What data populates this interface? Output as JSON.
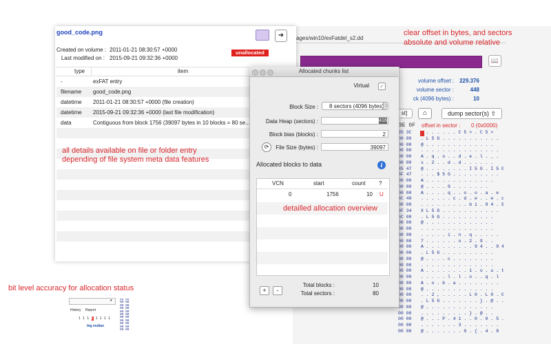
{
  "annotations": {
    "offsets_line1": "clear offset in bytes, and sectors",
    "offsets_line2": "absolute and volume relative",
    "details_line1": "all details available on file or folder entry",
    "details_line2": "depending of file system meta data features",
    "allocation": "detailled allocation overview",
    "bitlevel": "bit level accuracy for allocation status"
  },
  "background_app": {
    "path": "ages/win10/exFatdel_s2.dd",
    "volume_offset_label": "volume offset :",
    "volume_offset_value": "229.376",
    "volume_sector_label": "volume sector :",
    "volume_sector_value": "448",
    "block_label": "ck (4096 bytes) :",
    "block_value": "10",
    "reset_partial": "st]",
    "dump_label": "dump sector(s)",
    "hex_header": "0E 0F",
    "offset_sector_label": "offset in sector :",
    "offset_sector_value": "0 (0x0000)",
    "hex_lines": [
      "85 3C",
      "00 00",
      "00 00",
      "00 00",
      "00 00",
      "00 00",
      "85 47",
      "8F 47",
      "00 00",
      "00 00",
      "00 00",
      "8C 49",
      "00 00",
      "9F 34",
      "5C 00",
      "00 00",
      "00 00",
      "00 00",
      "00 00",
      "00 00",
      "00 00",
      "00 00",
      "00 00",
      "00 00",
      "00 00",
      "00 00",
      "00 00",
      "00 00",
      "00 00",
      "00 00",
      "00 00",
      "00 00",
      "00 00",
      "00 00"
    ],
    "ascii_lines": [
      ". . . . . . . C 5 > . C 5 >",
      ". L 5 G . . . . . . . . . . .",
      "@ . . . . . . . . . . . . .",
      ". . . . . . . . . . . . . . .",
      "A . q . o . . d . e . l . _ .",
      "s . 2 . . d . d . . . . . .",
      "@ . . . . . . . . I 5 G . I 5 G",
      ". . . $ 5 G . . . . . . . . .",
      "A . . . . . . . . . . . . .",
      "@ . . . . 9 . . . . . . .",
      "A . . . . q . . o . o . a . e",
      ". . . . . . c . d . e . . e . o",
      ". . . . . . . . . b i . 9 4 . 9 4",
      "X L 5 G . . . . . . . . . . .",
      ". L 5 G . . . . . . . . . .",
      "@ . . . . . . . . . . . . .",
      ". . . . . . . . . . . . . .",
      ". . . . . i . n . q . . . . .",
      "7 . . . . . . o . 2 . 9 . .",
      "A . . . . . . . . . 9 4 . . 9 4",
      ". L 5 G . . . . . . . . . .",
      "@ . . . . c . . . . . . . .",
      ". . . . . . . . . . . . . .",
      "A . . . . . . . . 1 . o . u . t",
      ". . . . . l . l . o . . q . l",
      "A . o . b . a . . . . . . . .",
      "@ . . . . . . . . . . . . .",
      ". . 2 , . . . . . L 0 . L 0 . 0",
      ". L 5 G . . . . . . . } . @ . .",
      "@ . . . . . . . . . . . . .",
      ". . . . . . . . . } . @ . .",
      "@ . . . P . 4 1 . . 0 . 0 . 5 . 8",
      ". . . . . . . 3 . . . . . . .",
      "@ . . . . . . . 0 . { . 4 . 8"
    ]
  },
  "file_window": {
    "title": "good_code.png",
    "created_label": "Created on volume :",
    "created_value": "2011-01-21 08:30:57 +0000",
    "modified_label": "Last modified on :",
    "modified_value": "2015-09-21 09:32:36 +0000",
    "status_badge": "unallocated",
    "col_type": "type",
    "col_item": "item",
    "rows": [
      {
        "type": "-",
        "item": "exFAT entry"
      },
      {
        "type": "filename",
        "item": "good_code.png"
      },
      {
        "type": "datetime",
        "item": "2011-01-21 08:30:57 +0000 (file creation)"
      },
      {
        "type": "datetime",
        "item": "2015-09-21 09:32:36 +0000 (last file modification)"
      },
      {
        "type": "data",
        "item": "Contiguous from block 1756 (39097 bytes in 10 blocks = 80 se..."
      }
    ]
  },
  "mini_widget": {
    "tab_history": "History",
    "tab_report": "Report",
    "bits": [
      "1",
      "1",
      "1",
      "1",
      "1",
      "1",
      "1",
      "1"
    ],
    "endian": "big endian",
    "hex_rows": [
      "00 00",
      "00 00",
      "00 00",
      "00 00",
      "00 00",
      "00 00",
      "00 00",
      "00 00",
      "00 00",
      "00 00",
      "00 00"
    ]
  },
  "chunk_dialog": {
    "title": "Allocated chunks list",
    "virtual_label": "Virtual",
    "virtual_check": "✓",
    "block_size_label": "Block Size :",
    "block_size_value": "8 sectors (4096 bytes)",
    "data_heap_label": "Data Heap (sectors) :",
    "data_heap_value": "416",
    "block_bias_label": "Block bias (blocks) :",
    "block_bias_value": "2",
    "file_size_label": "File Size (bytes) :",
    "file_size_value": "39097",
    "allocated_header": "Allocated blocks to data",
    "col_vcn": "VCN",
    "col_start": "start",
    "col_count": "count",
    "col_q": "?",
    "row_vcn": "0",
    "row_start": "1756",
    "row_count": "10",
    "row_flag": "U",
    "total_blocks_label": "Total blocks :",
    "total_blocks_value": "10",
    "total_sectors_label": "Total sectors :",
    "total_sectors_value": "80",
    "plus": "+",
    "minus": "-"
  },
  "colors": {
    "accent_red": "#d9262b",
    "purple_bar": "#8a2a8f",
    "link_blue": "#1a3fbd"
  }
}
